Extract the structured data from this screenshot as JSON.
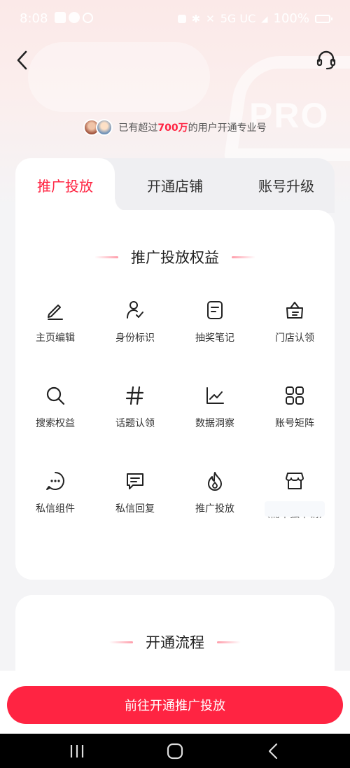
{
  "status_bar": {
    "time": "8:08",
    "network": "5G UC",
    "battery": "100%"
  },
  "header": {
    "back_icon": "chevron-left-icon",
    "service_icon": "headset-icon"
  },
  "users_banner": {
    "prefix": "已有超过",
    "count": "700万",
    "suffix": "的用户开通专业号"
  },
  "tabs": [
    {
      "label": "推广投放",
      "active": true
    },
    {
      "label": "开通店铺",
      "active": false
    },
    {
      "label": "账号升级",
      "active": false
    }
  ],
  "benefits": {
    "title": "推广投放权益",
    "items": [
      {
        "label": "主页编辑",
        "icon": "pencil-icon"
      },
      {
        "label": "身份标识",
        "icon": "user-check-icon"
      },
      {
        "label": "抽奖笔记",
        "icon": "note-icon"
      },
      {
        "label": "门店认领",
        "icon": "store-claim-icon"
      },
      {
        "label": "搜索权益",
        "icon": "search-icon"
      },
      {
        "label": "话题认领",
        "icon": "hashtag-icon"
      },
      {
        "label": "数据洞察",
        "icon": "line-chart-icon"
      },
      {
        "label": "账号矩阵",
        "icon": "grid-icon"
      },
      {
        "label": "私信组件",
        "icon": "chat-dots-icon"
      },
      {
        "label": "私信回复",
        "icon": "chat-lines-icon"
      },
      {
        "label": "推广投放",
        "icon": "fire-icon"
      },
      {
        "label": "",
        "icon": "shop-icon",
        "note": "（需单独申请）"
      }
    ]
  },
  "process": {
    "title": "开通流程"
  },
  "cta": {
    "label": "前往开通推广投放"
  },
  "colors": {
    "brand": "#ff2442",
    "hero_bg": "#fbe9e8",
    "page_bg": "#f4f4f6"
  }
}
